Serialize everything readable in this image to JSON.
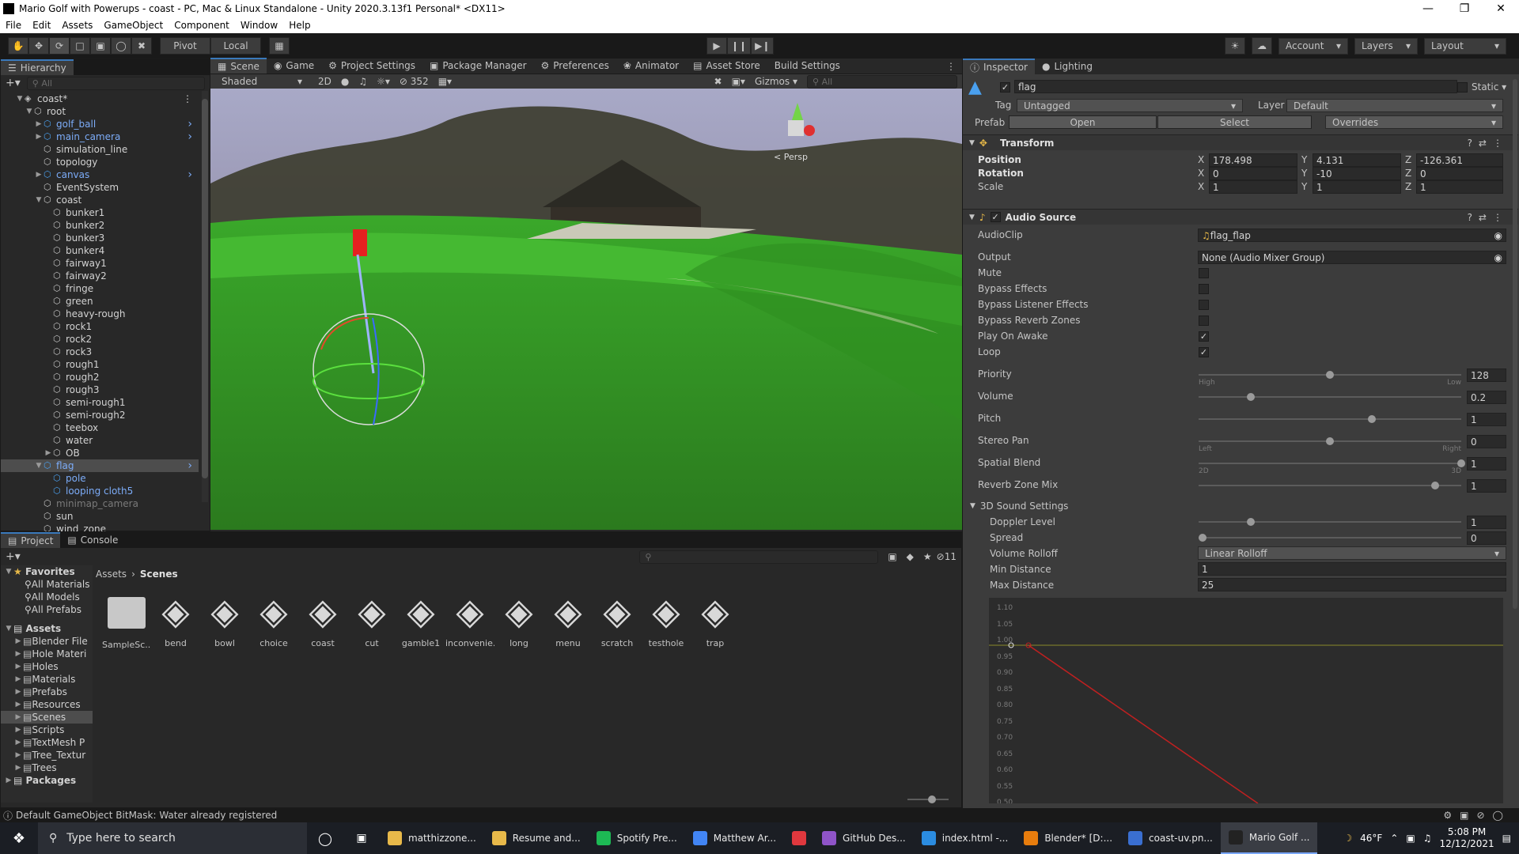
{
  "window": {
    "title": "Mario Golf with Powerups - coast - PC, Mac & Linux Standalone - Unity 2020.3.13f1 Personal* <DX11>"
  },
  "menu": [
    "File",
    "Edit",
    "Assets",
    "GameObject",
    "Component",
    "Window",
    "Help"
  ],
  "toolbar": {
    "pivot": "Pivot",
    "local": "Local",
    "account": "Account",
    "layers": "Layers",
    "layout": "Layout"
  },
  "hierarchy": {
    "tab": "Hierarchy",
    "search": "All",
    "items": [
      {
        "label": "coast*",
        "indent": 0,
        "style": "scene",
        "expand": "open"
      },
      {
        "label": "root",
        "indent": 1,
        "style": "normal",
        "expand": "open"
      },
      {
        "label": "golf_ball",
        "indent": 2,
        "style": "blue",
        "expand": "closed",
        "more": true
      },
      {
        "label": "main_camera",
        "indent": 2,
        "style": "blue",
        "expand": "closed",
        "more": true
      },
      {
        "label": "simulation_line",
        "indent": 2,
        "style": "normal"
      },
      {
        "label": "topology",
        "indent": 2,
        "style": "normal"
      },
      {
        "label": "canvas",
        "indent": 2,
        "style": "blue",
        "expand": "closed",
        "more": true
      },
      {
        "label": "EventSystem",
        "indent": 2,
        "style": "normal"
      },
      {
        "label": "coast",
        "indent": 2,
        "style": "normal",
        "expand": "open"
      },
      {
        "label": "bunker1",
        "indent": 3,
        "style": "normal"
      },
      {
        "label": "bunker2",
        "indent": 3,
        "style": "normal"
      },
      {
        "label": "bunker3",
        "indent": 3,
        "style": "normal"
      },
      {
        "label": "bunker4",
        "indent": 3,
        "style": "normal"
      },
      {
        "label": "fairway1",
        "indent": 3,
        "style": "normal"
      },
      {
        "label": "fairway2",
        "indent": 3,
        "style": "normal"
      },
      {
        "label": "fringe",
        "indent": 3,
        "style": "normal"
      },
      {
        "label": "green",
        "indent": 3,
        "style": "normal"
      },
      {
        "label": "heavy-rough",
        "indent": 3,
        "style": "normal"
      },
      {
        "label": "rock1",
        "indent": 3,
        "style": "normal"
      },
      {
        "label": "rock2",
        "indent": 3,
        "style": "normal"
      },
      {
        "label": "rock3",
        "indent": 3,
        "style": "normal"
      },
      {
        "label": "rough1",
        "indent": 3,
        "style": "normal"
      },
      {
        "label": "rough2",
        "indent": 3,
        "style": "normal"
      },
      {
        "label": "rough3",
        "indent": 3,
        "style": "normal"
      },
      {
        "label": "semi-rough1",
        "indent": 3,
        "style": "normal"
      },
      {
        "label": "semi-rough2",
        "indent": 3,
        "style": "normal"
      },
      {
        "label": "teebox",
        "indent": 3,
        "style": "normal"
      },
      {
        "label": "water",
        "indent": 3,
        "style": "normal"
      },
      {
        "label": "OB",
        "indent": 3,
        "style": "normal",
        "expand": "closed"
      },
      {
        "label": "flag",
        "indent": 2,
        "style": "blue-sel",
        "expand": "open",
        "more": true
      },
      {
        "label": "pole",
        "indent": 3,
        "style": "blue"
      },
      {
        "label": "looping cloth5",
        "indent": 3,
        "style": "blue"
      },
      {
        "label": "minimap_camera",
        "indent": 2,
        "style": "dim"
      },
      {
        "label": "sun",
        "indent": 2,
        "style": "normal"
      },
      {
        "label": "wind_zone",
        "indent": 2,
        "style": "normal"
      }
    ]
  },
  "scene_tabs": [
    "Scene",
    "Game",
    "Project Settings",
    "Package Manager",
    "Preferences",
    "Animator",
    "Asset Store",
    "Build Settings"
  ],
  "scene": {
    "shading": "Shaded",
    "mode2d": "2D",
    "fx_count": "352",
    "gizmos": "Gizmos",
    "search": "All",
    "persp": "< Persp"
  },
  "inspector": {
    "tabs": [
      "Inspector",
      "Lighting"
    ],
    "name": "flag",
    "static": "Static",
    "tag_label": "Tag",
    "tag": "Untagged",
    "layer_label": "Layer",
    "layer": "Default",
    "prefab_label": "Prefab",
    "open": "Open",
    "select": "Select",
    "overrides": "Overrides",
    "transform": {
      "title": "Transform",
      "rows": [
        {
          "label": "Position",
          "x": "178.498",
          "y": "4.131",
          "z": "-126.361"
        },
        {
          "label": "Rotation",
          "x": "0",
          "y": "-10",
          "z": "0"
        },
        {
          "label": "Scale",
          "x": "1",
          "y": "1",
          "z": "1"
        }
      ]
    },
    "audio": {
      "title": "Audio Source",
      "audioclip_label": "AudioClip",
      "audioclip": "flag_flap",
      "output_label": "Output",
      "output": "None (Audio Mixer Group)",
      "checks": [
        {
          "label": "Mute",
          "checked": false
        },
        {
          "label": "Bypass Effects",
          "checked": false
        },
        {
          "label": "Bypass Listener Effects",
          "checked": false
        },
        {
          "label": "Bypass Reverb Zones",
          "checked": false
        },
        {
          "label": "Play On Awake",
          "checked": true
        },
        {
          "label": "Loop",
          "checked": true
        }
      ],
      "sliders": [
        {
          "label": "Priority",
          "value": "128",
          "fraction": 0.5,
          "left": "High",
          "right": "Low"
        },
        {
          "label": "Volume",
          "value": "0.2",
          "fraction": 0.2,
          "left": "",
          "right": ""
        },
        {
          "label": "Pitch",
          "value": "1",
          "fraction": 0.66,
          "left": "",
          "right": ""
        },
        {
          "label": "Stereo Pan",
          "value": "0",
          "fraction": 0.5,
          "left": "Left",
          "right": "Right"
        },
        {
          "label": "Spatial Blend",
          "value": "1",
          "fraction": 1.0,
          "left": "2D",
          "right": "3D"
        },
        {
          "label": "Reverb Zone Mix",
          "value": "1",
          "fraction": 0.9,
          "left": "",
          "right": ""
        }
      ],
      "sound3d": {
        "title": "3D Sound Settings",
        "doppler_label": "Doppler Level",
        "doppler": "1",
        "doppler_fraction": 0.2,
        "spread_label": "Spread",
        "spread": "0",
        "spread_fraction": 0.0,
        "rolloff_label": "Volume Rolloff",
        "rolloff": "Linear Rolloff",
        "min_label": "Min Distance",
        "min": "1",
        "max_label": "Max Distance",
        "max": "25"
      },
      "graph_ticks": [
        "1.10",
        "1.05",
        "1.00",
        "0.95",
        "0.90",
        "0.85",
        "0.80",
        "0.75",
        "0.70",
        "0.65",
        "0.60",
        "0.55",
        "0.50"
      ]
    }
  },
  "project": {
    "tabs": [
      "Project",
      "Console"
    ],
    "hidden_count": "11",
    "favorites_title": "Favorites",
    "favorites": [
      "All Materials",
      "All Models",
      "All Prefabs"
    ],
    "assets_title": "Assets",
    "folders": [
      "Blender File",
      "Hole Materi",
      "Holes",
      "Materials",
      "Prefabs",
      "Resources",
      "Scenes",
      "Scripts",
      "TextMesh P",
      "Tree_Textur",
      "Trees"
    ],
    "packages": "Packages",
    "breadcrumb": [
      "Assets",
      "Scenes"
    ],
    "items": [
      "SampleSc...",
      "bend",
      "bowl",
      "choice",
      "coast",
      "cut",
      "gamble1",
      "inconvenie...",
      "long",
      "menu",
      "scratch",
      "testhole",
      "trap"
    ]
  },
  "status": "Default GameObject BitMask: Water already registered",
  "taskbar": {
    "search": "Type here to search",
    "apps": [
      {
        "label": "matthizzone...",
        "color": "#e8b94a"
      },
      {
        "label": "Resume and...",
        "color": "#e8b94a"
      },
      {
        "label": "Spotify Pre...",
        "color": "#1db954"
      },
      {
        "label": "Matthew Ar...",
        "color": "#4285f4"
      },
      {
        "label": "",
        "color": "#e0383e"
      },
      {
        "label": "GitHub Des...",
        "color": "#8f54c8"
      },
      {
        "label": "index.html -...",
        "color": "#2b8ce0"
      },
      {
        "label": "Blender* [D:...",
        "color": "#e87d0d"
      },
      {
        "label": "coast-uv.pn...",
        "color": "#3a6fd1"
      },
      {
        "label": "Mario Golf ...",
        "color": "#222222"
      }
    ],
    "weather": "46°F",
    "time": "5:08 PM",
    "date": "12/12/2021"
  }
}
